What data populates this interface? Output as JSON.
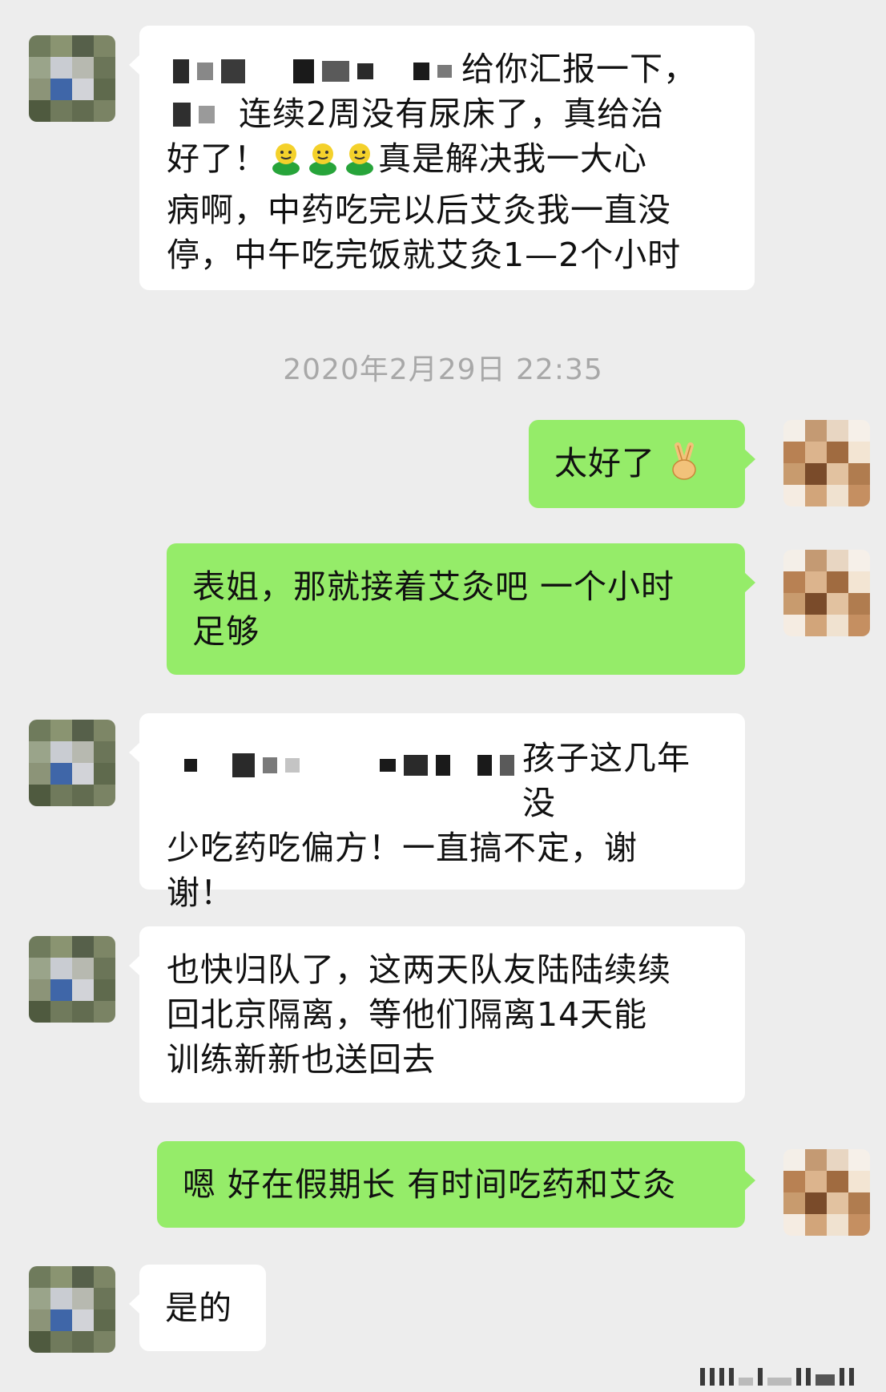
{
  "chat": {
    "messages": [
      {
        "text": "给你汇报一下，",
        "text2": "连续2周没有尿床了，真给治",
        "text3": "好了！",
        "text4": "真是解决我一大心",
        "text5": "病啊，中药吃完以后艾灸我一直没",
        "text6": "停，中午吃完饭就艾灸1—2个小时"
      },
      {
        "timestamp": "2020年2月29日 22:35"
      },
      {
        "text": "太好了"
      },
      {
        "text": "表姐，那就接着艾灸吧 一个小时",
        "text2": "足够"
      },
      {
        "text": "孩子这几年没",
        "text2": "少吃药吃偏方！一直搞不定，谢",
        "text3": "谢！"
      },
      {
        "text": "也快归队了，这两天队友陆陆续续",
        "text2": "回北京隔离，等他们隔离14天能",
        "text3": "训练新新也送回去"
      },
      {
        "text": "嗯 好在假期长 有时间吃药和艾灸"
      },
      {
        "text": "是的"
      }
    ]
  },
  "icons": {
    "emoji_smile": "green-smiley-icon",
    "emoji_victory": "victory-hand-icon"
  },
  "colors": {
    "background": "#ededed",
    "received_bubble": "#ffffff",
    "sent_bubble": "#95ec69",
    "timestamp_text": "#a8a8a8"
  }
}
